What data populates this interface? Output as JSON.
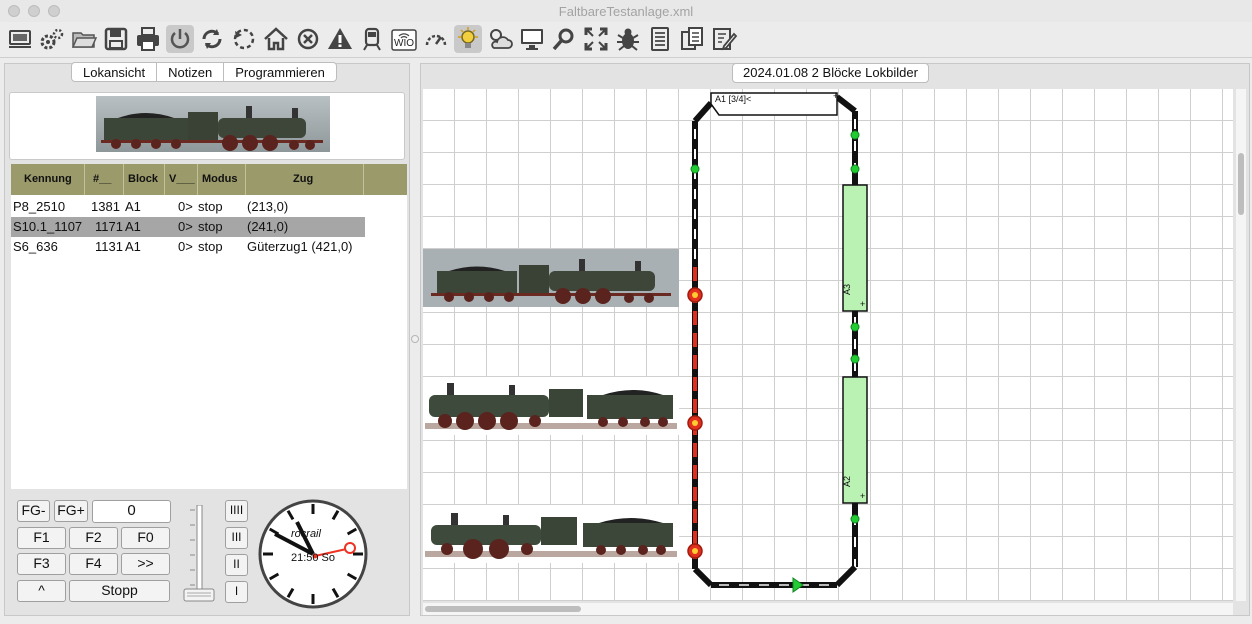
{
  "window": {
    "title": "FaltbareTestanlage.xml"
  },
  "toolbar": {
    "icons": [
      "monitor-network-icon",
      "gears-icon",
      "folder-open-icon",
      "save-icon",
      "print-icon",
      "power-icon",
      "sync-icon",
      "undo-circle-icon",
      "home-icon",
      "cancel-icon",
      "warning-icon",
      "train-icon",
      "wio-icon",
      "speedometer-icon",
      "lightbulb-icon",
      "weather-icon",
      "monitor-icon",
      "search-icon",
      "fullscreen-icon",
      "bug-icon",
      "list-icon",
      "copy-icon",
      "edit-icon"
    ]
  },
  "left_panel": {
    "tabs": [
      {
        "label": "Lokansicht"
      },
      {
        "label": "Notizen"
      },
      {
        "label": "Programmieren"
      }
    ],
    "table": {
      "headers": [
        "Kennung",
        "#__",
        "Block",
        "V___",
        "Modus",
        "Zug"
      ],
      "rows": [
        {
          "kennung": "P8_2510",
          "nr": "1381",
          "block": "A1",
          "v": "0>",
          "modus": "stop",
          "zug": "(213,0)"
        },
        {
          "kennung": "S10.1_1107",
          "nr": "1171",
          "block": "A1",
          "v": "0>",
          "modus": "stop",
          "zug": "(241,0)"
        },
        {
          "kennung": "S6_636",
          "nr": "1131",
          "block": "A1",
          "v": "0>",
          "modus": "stop",
          "zug": "Güterzug1 (421,0)"
        }
      ]
    },
    "controls": {
      "fg_minus": "FG-",
      "fg_plus": "FG+",
      "speed": "0",
      "f1": "F1",
      "f2": "F2",
      "f0": "F0",
      "f3": "F3",
      "f4": "F4",
      "more": ">>",
      "up": "^",
      "stopp": "Stopp",
      "steps": [
        "IIII",
        "III",
        "II",
        "I"
      ]
    },
    "clock": {
      "brand": "rocrail",
      "time": "21:50 So"
    }
  },
  "right_panel": {
    "title": "2024.01.08 2 Blöcke Lokbilder",
    "blocks": {
      "a1": "A1 [3/4]<",
      "a2": "A2",
      "a3": "A3"
    }
  },
  "colors": {
    "panel_bg": "#e3e3e3",
    "table_header": "#9b9a6a",
    "block_fill": "#b9f2b2",
    "signal_red": "#e0301d",
    "sensor_green": "#22cc33"
  }
}
